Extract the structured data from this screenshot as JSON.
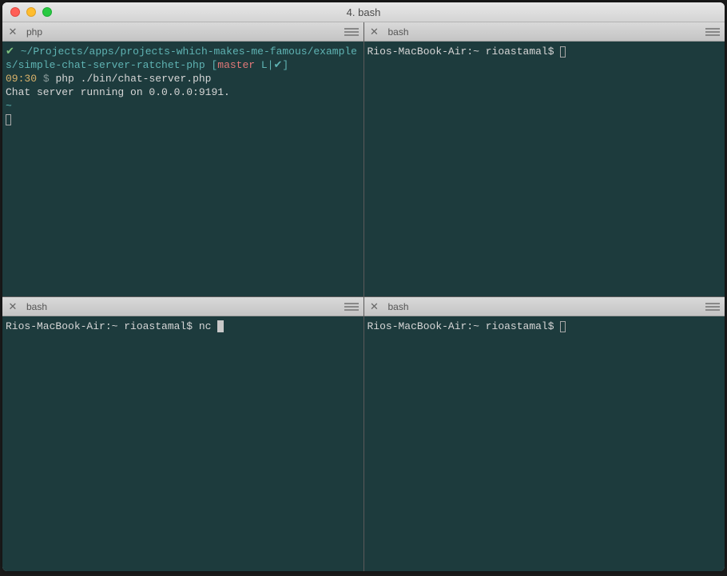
{
  "window": {
    "title": "4. bash"
  },
  "panes": {
    "top_left": {
      "tab_label": "php",
      "prompt_mark": "✔",
      "path": "~/Projects/apps/projects-which-makes-me-famous/examples/simple-chat-server-ratchet-php",
      "branch_open": "[",
      "branch": "master",
      "branch_status": " L|✔",
      "branch_close": "]",
      "time": "09:30",
      "prompt_symbol": "$",
      "command": "php ./bin/chat-server.php",
      "output_line": "Chat server running on 0.0.0.0:9191.",
      "dash": "~"
    },
    "top_right": {
      "tab_label": "bash",
      "prompt": "Rios-MacBook-Air:~ rioastamal$"
    },
    "bottom_left": {
      "tab_label": "bash",
      "prompt": "Rios-MacBook-Air:~ rioastamal$",
      "command": "nc"
    },
    "bottom_right": {
      "tab_label": "bash",
      "prompt": "Rios-MacBook-Air:~ rioastamal$"
    }
  }
}
